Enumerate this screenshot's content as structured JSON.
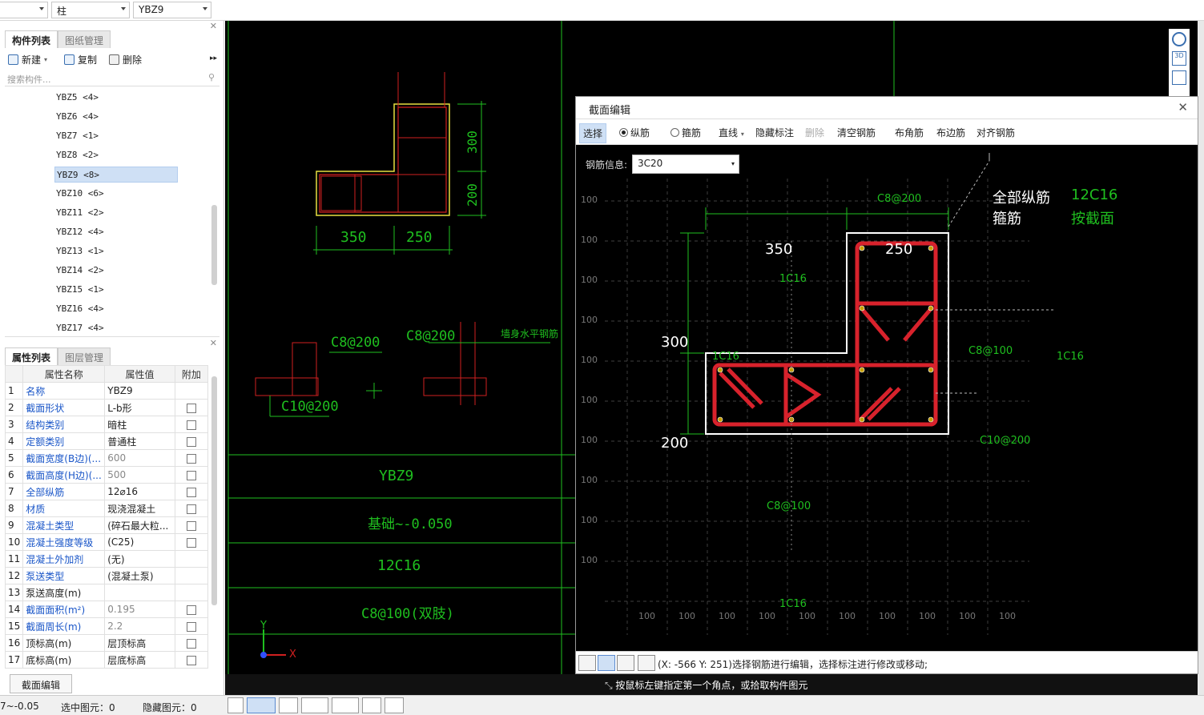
{
  "topbar": {
    "select1": "",
    "select2": "柱",
    "select3": "YBZ9"
  },
  "component_panel": {
    "tabs": [
      "构件列表",
      "图纸管理"
    ],
    "toolbar": {
      "new": "新建",
      "copy": "复制",
      "delete": "删除"
    },
    "search_placeholder": "搜索构件...",
    "items": [
      "YBZ5 <4>",
      "YBZ6 <4>",
      "YBZ7 <1>",
      "YBZ8 <2>",
      "YBZ9 <8>",
      "YBZ10 <6>",
      "YBZ11 <2>",
      "YBZ12 <4>",
      "YBZ13 <1>",
      "YBZ14 <2>",
      "YBZ15 <1>",
      "YBZ16 <4>",
      "YBZ17 <4>"
    ],
    "selected_index": 4
  },
  "property_panel": {
    "tabs": [
      "属性列表",
      "图层管理"
    ],
    "columns": [
      "属性名称",
      "属性值",
      "附加"
    ],
    "rows": [
      {
        "n": "1",
        "name": "名称",
        "value": "YBZ9",
        "blue": true,
        "gray": false,
        "cb": false
      },
      {
        "n": "2",
        "name": "截面形状",
        "value": "L-b形",
        "blue": true,
        "gray": false,
        "cb": true
      },
      {
        "n": "3",
        "name": "结构类别",
        "value": "暗柱",
        "blue": true,
        "gray": false,
        "cb": true
      },
      {
        "n": "4",
        "name": "定额类别",
        "value": "普通柱",
        "blue": true,
        "gray": false,
        "cb": true
      },
      {
        "n": "5",
        "name": "截面宽度(B边)(...",
        "value": "600",
        "blue": true,
        "gray": true,
        "cb": true
      },
      {
        "n": "6",
        "name": "截面高度(H边)(...",
        "value": "500",
        "blue": true,
        "gray": true,
        "cb": true
      },
      {
        "n": "7",
        "name": "全部纵筋",
        "value": "12⌀16",
        "blue": true,
        "gray": false,
        "cb": true
      },
      {
        "n": "8",
        "name": "材质",
        "value": "现浇混凝土",
        "blue": true,
        "gray": false,
        "cb": true
      },
      {
        "n": "9",
        "name": "混凝土类型",
        "value": "(碎石最大粒...",
        "blue": true,
        "gray": false,
        "cb": true
      },
      {
        "n": "10",
        "name": "混凝土强度等级",
        "value": "(C25)",
        "blue": true,
        "gray": false,
        "cb": true
      },
      {
        "n": "11",
        "name": "混凝土外加剂",
        "value": "(无)",
        "blue": true,
        "gray": false,
        "cb": false
      },
      {
        "n": "12",
        "name": "泵送类型",
        "value": "(混凝土泵)",
        "blue": true,
        "gray": false,
        "cb": false
      },
      {
        "n": "13",
        "name": "泵送高度(m)",
        "value": "",
        "blue": false,
        "gray": false,
        "cb": false
      },
      {
        "n": "14",
        "name": "截面面积(m²)",
        "value": "0.195",
        "blue": true,
        "gray": true,
        "cb": true
      },
      {
        "n": "15",
        "name": "截面周长(m)",
        "value": "2.2",
        "blue": true,
        "gray": true,
        "cb": true
      },
      {
        "n": "16",
        "name": "顶标高(m)",
        "value": "层顶标高",
        "blue": false,
        "gray": false,
        "cb": true
      },
      {
        "n": "17",
        "name": "底标高(m)",
        "value": "层底标高",
        "blue": false,
        "gray": false,
        "cb": true
      }
    ],
    "edit_button": "截面编辑"
  },
  "statusbar": {
    "elevation": "7~-0.05",
    "selected": "选中图元：0",
    "hidden": "隐藏图元：0"
  },
  "cad": {
    "dims_top": [
      "350",
      "250"
    ],
    "dims_side": [
      "300",
      "200"
    ],
    "hoop_labels": [
      "C8@200",
      "C8@200",
      "C10@200"
    ],
    "vertical_note": "墙身水平钢筋",
    "table_rows": [
      "YBZ9",
      "基础~-0.050",
      "12C16",
      "C8@100(双肢)"
    ],
    "axis_y": "Y",
    "axis_x": "X",
    "command_hint": "按鼠标左键指定第一个角点，或拾取构件图元"
  },
  "dialog": {
    "title": "截面编辑",
    "toolbar": {
      "select": "选择",
      "radio_long": "纵筋",
      "radio_hoop": "箍筋",
      "line": "直线",
      "hide_dim": "隐藏标注",
      "delete": "删除",
      "clear": "清空钢筋",
      "corner": "布角筋",
      "edge": "布边筋",
      "align": "对齐钢筋"
    },
    "rebar_info_label": "钢筋信息:",
    "rebar_info_value": "3C20",
    "grid_label": "100",
    "legend": {
      "all_long_label": "全部纵筋",
      "all_long_value": "12C16",
      "hoop_label": "箍筋",
      "hoop_value": "按截面"
    },
    "dims": {
      "w1": "350",
      "w2": "250",
      "h1": "300",
      "h2": "200"
    },
    "labels": {
      "c8_top": "C8@200",
      "c16_top": "1C16",
      "c16_left": "1C16",
      "c16_right": "1C16",
      "c16_bottom": "1C16",
      "c8_right": "C8@100",
      "c10": "C10@200",
      "c8_bottom": "C8@100"
    },
    "status_text": "(X: -566 Y: 251)选择钢筋进行编辑，选择标注进行修改或移动;"
  }
}
